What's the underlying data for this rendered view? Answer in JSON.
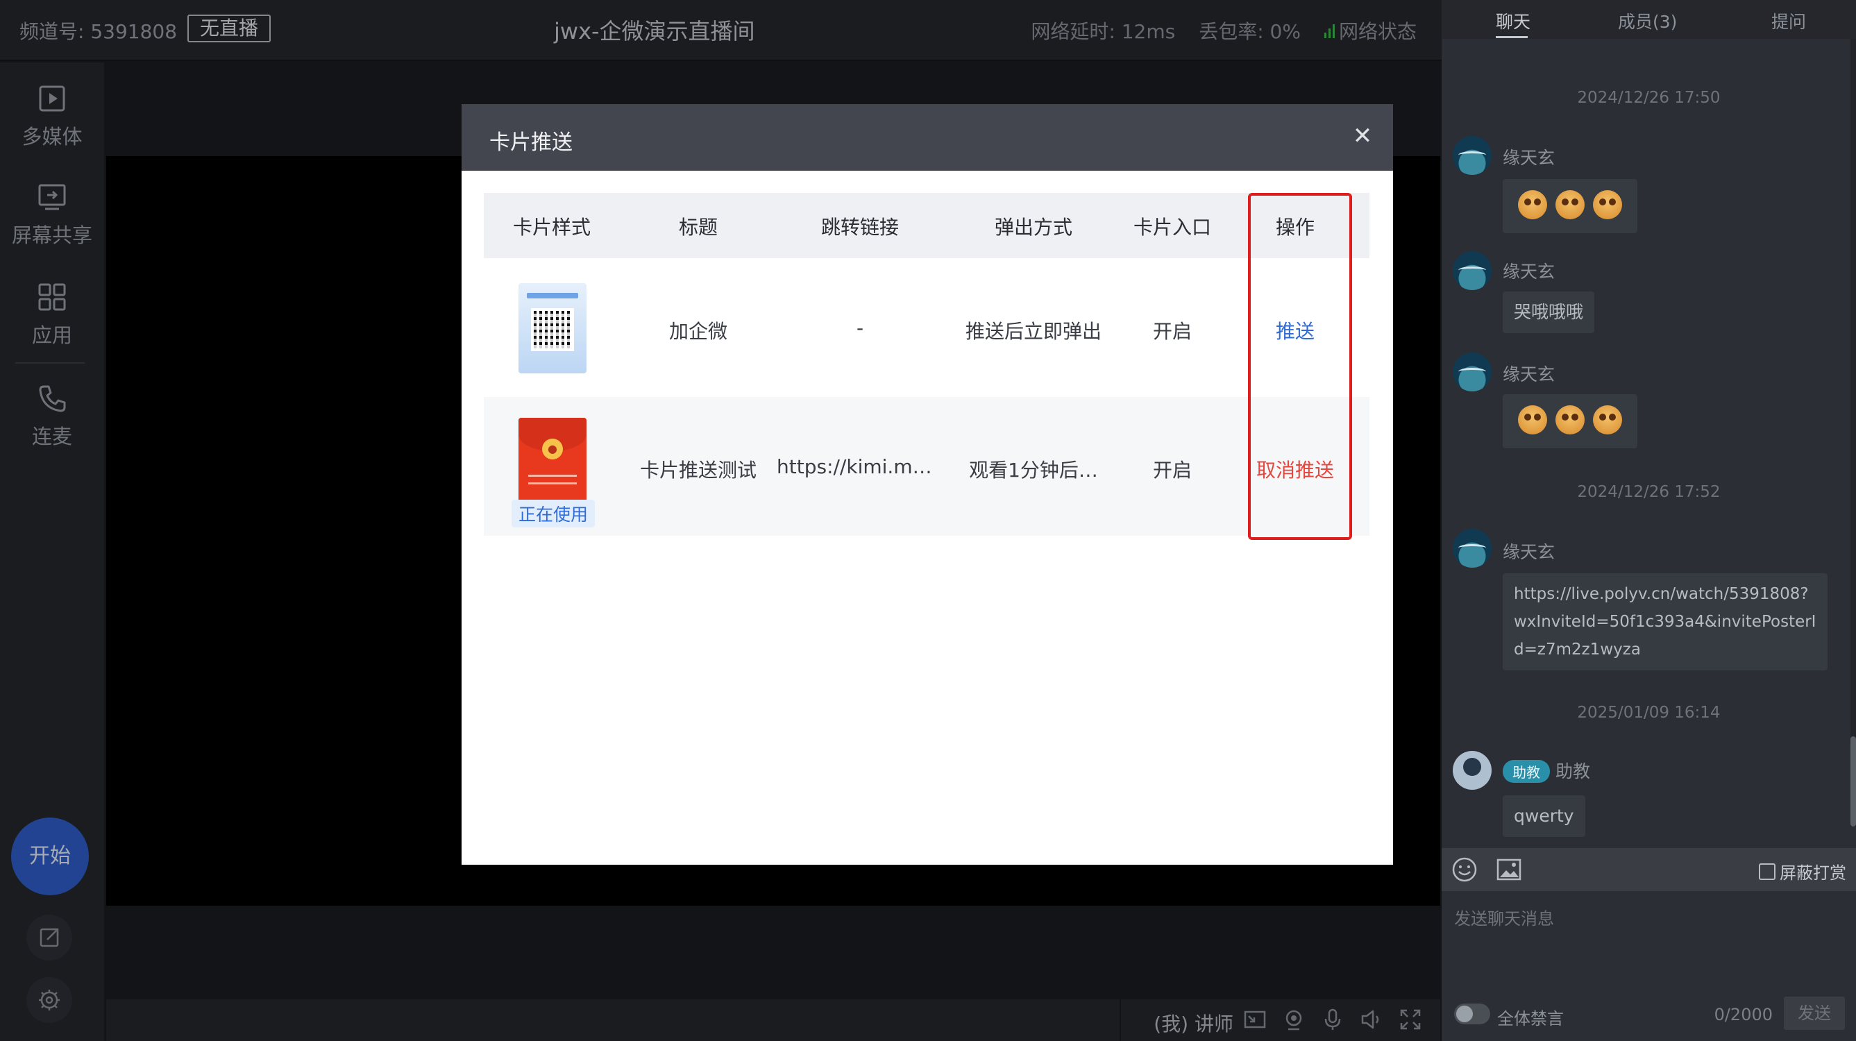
{
  "header": {
    "channel": "频道号: 5391808",
    "live_status": "无直播",
    "room_title": "jwx-企微演示直播间",
    "latency": "网络延时: 12ms",
    "packet_loss": "丢包率: 0%",
    "network_status": "网络状态"
  },
  "sidebar": {
    "items": [
      {
        "label": "多媒体",
        "icon": "play-box-icon"
      },
      {
        "label": "屏幕共享",
        "icon": "screen-share-icon"
      },
      {
        "label": "应用",
        "icon": "grid-icon"
      },
      {
        "label": "连麦",
        "icon": "phone-icon"
      }
    ],
    "start_label": "开始"
  },
  "footer": {
    "lecturer": "(我) 讲师"
  },
  "chat": {
    "tabs": [
      "聊天",
      "成员(3)",
      "提问"
    ],
    "timestamps": [
      "2024/12/26 17:50",
      "2024/12/26 17:52",
      "2025/01/09 16:14"
    ],
    "messages": [
      {
        "user": "缘天玄",
        "text": ""
      },
      {
        "user": "缘天玄",
        "text": "哭哦哦哦"
      },
      {
        "user": "缘天玄",
        "text": ""
      },
      {
        "user": "缘天玄",
        "text": "https://live.polyv.cn/watch/5391808?wxInviteId=50f1c393a4&invitePosterId=z7m2z1wyza"
      },
      {
        "user": "助教",
        "role": "助教",
        "text": "qwerty"
      }
    ],
    "block_reward": "屏蔽打赏",
    "input_placeholder": "发送聊天消息",
    "mute_all": "全体禁言",
    "counter": "0/2000",
    "send": "发送"
  },
  "modal": {
    "title": "卡片推送",
    "columns": [
      "卡片样式",
      "标题",
      "跳转链接",
      "弹出方式",
      "卡片入口",
      "操作"
    ],
    "rows": [
      {
        "title": "加企微",
        "link": "-",
        "popup": "推送后立即弹出",
        "entry": "开启",
        "action": "推送",
        "in_use": ""
      },
      {
        "title": "卡片推送测试",
        "link": "https://kimi.mo…",
        "popup": "观看1分钟后…",
        "entry": "开启",
        "action": "取消推送",
        "in_use": "正在使用"
      }
    ]
  },
  "colors": {
    "accent_blue": "#2f6bd9",
    "danger_red": "#e8453c",
    "highlight_red": "#e01d1d",
    "start_button": "#2f5ec9"
  }
}
